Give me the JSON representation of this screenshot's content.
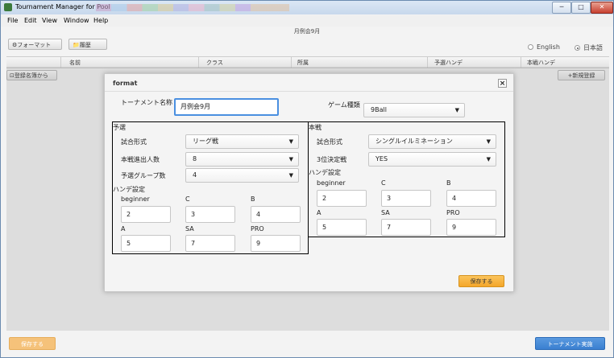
{
  "window": {
    "title": "Tournament Manager for Pool",
    "minimize": "─",
    "maximize": "□",
    "close": "✕"
  },
  "menu": {
    "file": "File",
    "edit": "Edit",
    "view": "View",
    "window": "Window",
    "help": "Help"
  },
  "page_title": "月例会9月",
  "toolbar": {
    "format_icon": "gear-icon",
    "format_label": "⚙フォーマット",
    "history_icon": "folder-icon",
    "history_label": "📁履歴"
  },
  "language": {
    "english": "English",
    "japanese": "日本語",
    "selected": "日本語"
  },
  "table": {
    "headers": [
      "名前",
      "クラス",
      "所属",
      "予選ハンデ",
      "本戦ハンデ"
    ]
  },
  "buttons": {
    "import_roster": "⊡登録名簿から",
    "new_registration": "+新規登録",
    "save_bottom": "保存する",
    "start_tournament": "トーナメント実施"
  },
  "dialog": {
    "title": "format",
    "close": "×",
    "tournament_name_label": "トーナメント名称",
    "tournament_name_value": "月例会9月",
    "game_type_label": "ゲーム種類",
    "game_type_value": "9Ball",
    "save": "保存する",
    "prelim": {
      "title": "予選",
      "match_format_label": "試合形式",
      "match_format_value": "リーグ戦",
      "advance_count_label": "本戦進出人数",
      "advance_count_value": "8",
      "group_count_label": "予選グループ数",
      "group_count_value": "4",
      "handicap_title": "ハンデ設定",
      "handicaps": [
        {
          "label": "beginner",
          "value": "2"
        },
        {
          "label": "C",
          "value": "3"
        },
        {
          "label": "B",
          "value": "4"
        },
        {
          "label": "A",
          "value": "5"
        },
        {
          "label": "SA",
          "value": "7"
        },
        {
          "label": "PRO",
          "value": "9"
        }
      ]
    },
    "main": {
      "title": "本戦",
      "match_format_label": "試合形式",
      "match_format_value": "シングルイルミネーション",
      "third_place_label": "3位決定戦",
      "third_place_value": "YES",
      "handicap_title": "ハンデ設定",
      "handicaps": [
        {
          "label": "beginner",
          "value": "2"
        },
        {
          "label": "C",
          "value": "3"
        },
        {
          "label": "B",
          "value": "4"
        },
        {
          "label": "A",
          "value": "5"
        },
        {
          "label": "SA",
          "value": "7"
        },
        {
          "label": "PRO",
          "value": "9"
        }
      ]
    }
  },
  "colors": {
    "accent_orange": "#f4a62a",
    "accent_blue": "#3a7fd0",
    "focus_border": "#4a8fe0"
  }
}
